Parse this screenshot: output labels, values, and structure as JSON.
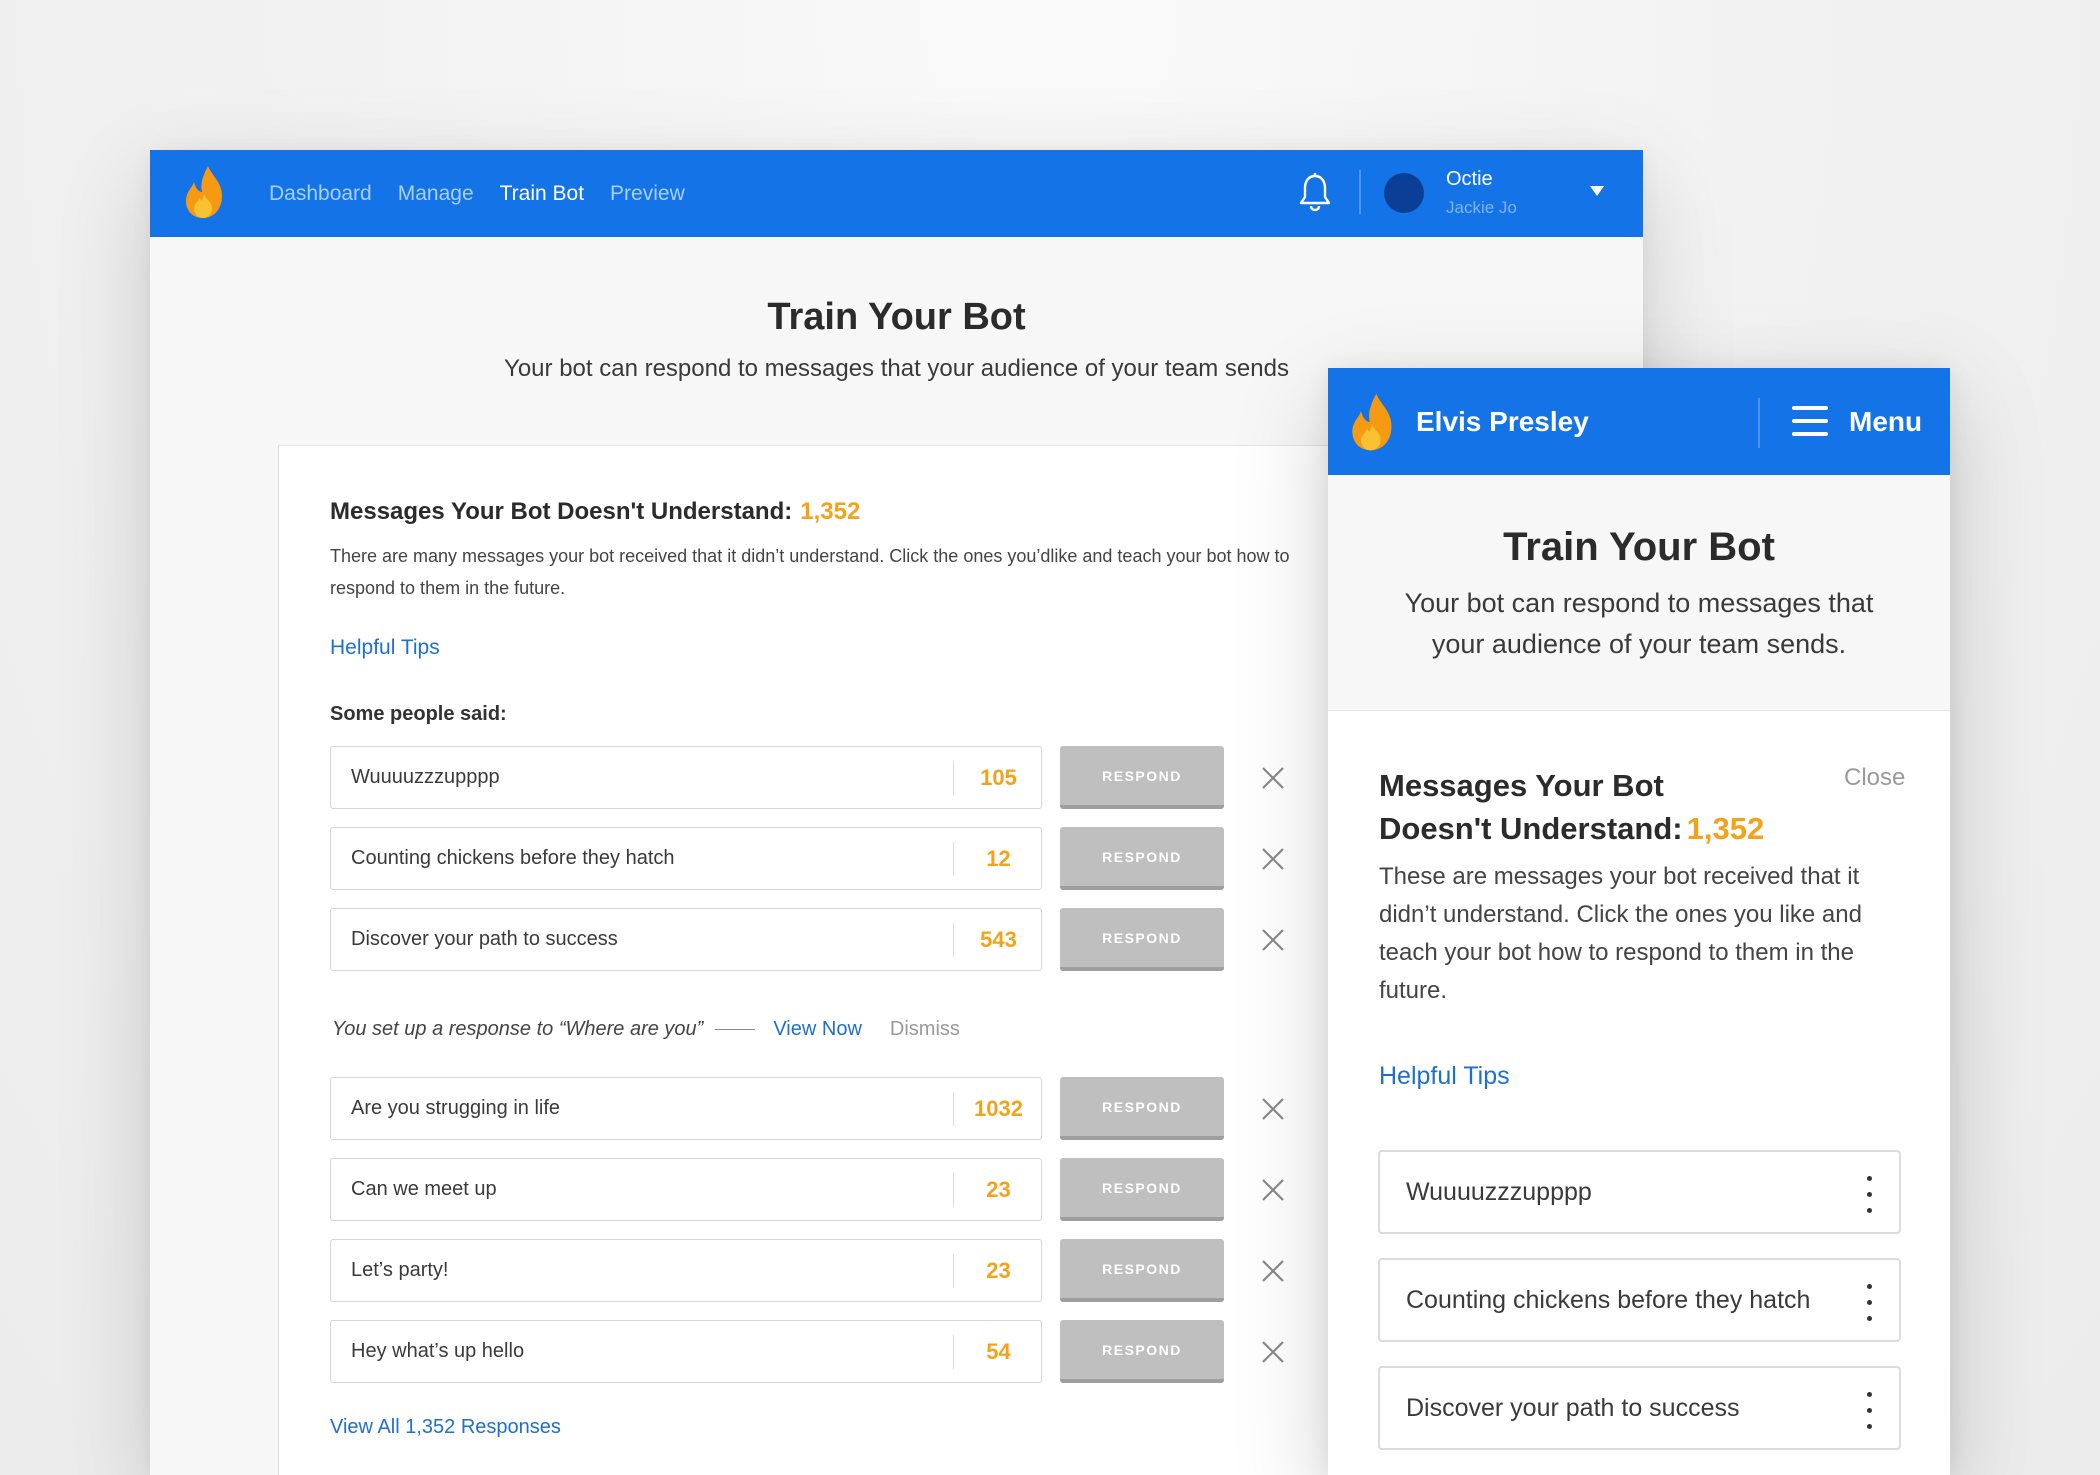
{
  "desktop": {
    "nav": {
      "links": [
        "Dashboard",
        "Manage",
        "Train Bot",
        "Preview"
      ],
      "active_link": "Train Bot",
      "user_name": "Octie",
      "user_sub": "Jackie Jo"
    },
    "title": "Train Your Bot",
    "subtitle": "Your bot can respond to messages that your audience of your team sends",
    "card": {
      "title": "Messages Your Bot Doesn't Understand:",
      "count": "1,352",
      "description": "There are many messages your bot received that it didn’t understand. Click the ones you’dlike and teach your bot how to respond to them in the future.",
      "tips_link": "Helpful Tips",
      "some_people_said": "Some people said:",
      "respond_label": "RESPOND",
      "messages": [
        {
          "text": "Wuuuuzzzupppp",
          "count": "105"
        },
        {
          "text": "Counting chickens before they hatch",
          "count": "12"
        },
        {
          "text": "Discover your path to success",
          "count": "543"
        },
        {
          "text": "Are you strugging in life",
          "count": "1032"
        },
        {
          "text": "Can we meet up",
          "count": "23"
        },
        {
          "text": "Let’s party!",
          "count": "23"
        },
        {
          "text": "Hey what’s up hello",
          "count": "54"
        }
      ],
      "notice": {
        "text": "You set up a response to “Where are you”",
        "view_label": "View Now",
        "dismiss_label": "Dismiss"
      },
      "view_all": "View All 1,352 Responses"
    }
  },
  "mobile": {
    "brand": "Elvis Presley",
    "menu_label": "Menu",
    "title": "Train Your Bot",
    "subtitle": "Your bot can respond to messages that your audience of your team sends.",
    "card": {
      "title": "Messages Your Bot Doesn't Understand:",
      "count": "1,352",
      "close_label": "Close",
      "description": "These are messages your bot received that it didn’t understand. Click the ones you like and teach your bot how to respond to them in the future.",
      "tips_link": "Helpful Tips",
      "items": [
        "Wuuuuzzzupppp",
        "Counting chickens before they hatch",
        "Discover your path to success"
      ]
    }
  },
  "colors": {
    "brand_blue": "#1473e6",
    "accent_orange": "#f5a21b",
    "link_blue": "#1e6fd0"
  },
  "icons": [
    "flame-logo-icon",
    "bell-icon",
    "chevron-down-icon",
    "close-icon",
    "hamburger-icon",
    "kebab-icon"
  ]
}
